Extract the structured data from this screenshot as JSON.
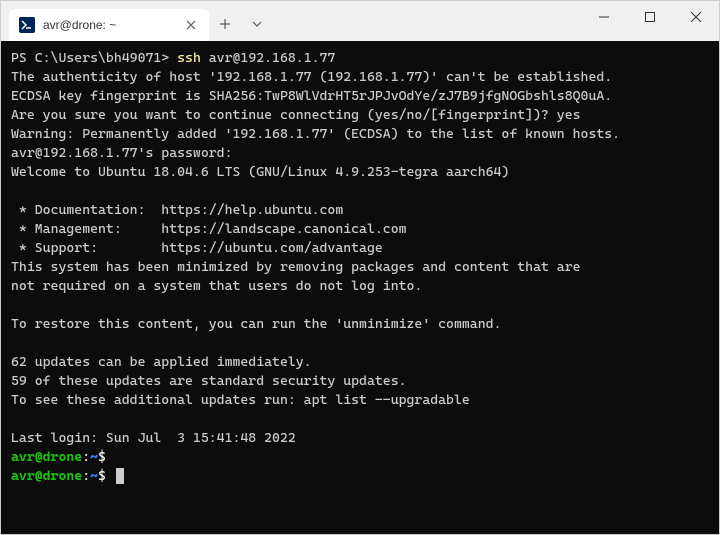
{
  "tab": {
    "title": "avr@drone: ~"
  },
  "terminal": {
    "ps_prompt": "PS C:\\Users\\bh49071> ",
    "ssh_cmd_prefix": "ssh ",
    "ssh_cmd_arg": "avr@192.168.1.77",
    "line_auth1": "The authenticity of host '192.168.1.77 (192.168.1.77)' can't be established.",
    "line_auth2": "ECDSA key fingerprint is SHA256:TwP8WlVdrHT5rJPJvOdYe/zJ7B9jfgNOGbshls8Q0uA.",
    "line_auth3": "Are you sure you want to continue connecting (yes/no/[fingerprint])? yes",
    "line_warn": "Warning: Permanently added '192.168.1.77' (ECDSA) to the list of known hosts.",
    "line_pass": "avr@192.168.1.77's password:",
    "line_welcome": "Welcome to Ubuntu 18.04.6 LTS (GNU/Linux 4.9.253-tegra aarch64)",
    "line_doc": " * Documentation:  https://help.ubuntu.com",
    "line_mgmt": " * Management:     https://landscape.canonical.com",
    "line_support": " * Support:        https://ubuntu.com/advantage",
    "line_min1": "This system has been minimized by removing packages and content that are",
    "line_min2": "not required on a system that users do not log into.",
    "line_restore": "To restore this content, you can run the 'unminimize' command.",
    "line_upd1": "62 updates can be applied immediately.",
    "line_upd2": "59 of these updates are standard security updates.",
    "line_upd3": "To see these additional updates run: apt list --upgradable",
    "line_last": "Last login: Sun Jul  3 15:41:48 2022",
    "prompt_user": "avr@drone",
    "prompt_colon": ":",
    "prompt_path": "~",
    "prompt_dollar": "$"
  }
}
